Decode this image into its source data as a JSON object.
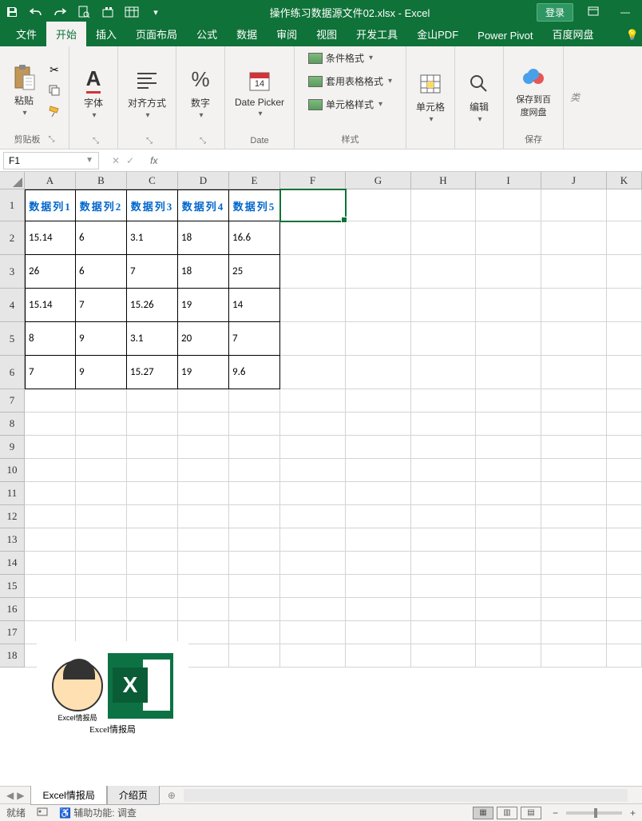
{
  "titlebar": {
    "filename": "操作练习数据源文件02.xlsx",
    "appname": "Excel",
    "separator": " - ",
    "login": "登录"
  },
  "tabs": [
    "文件",
    "开始",
    "插入",
    "页面布局",
    "公式",
    "数据",
    "审阅",
    "视图",
    "开发工具",
    "金山PDF",
    "Power Pivot",
    "百度网盘"
  ],
  "active_tab_index": 1,
  "ribbon": {
    "clipboard": {
      "label": "剪贴板",
      "paste": "粘贴"
    },
    "font": {
      "label": "字体"
    },
    "alignment": {
      "label": "对齐方式"
    },
    "number": {
      "label": "数字"
    },
    "date": {
      "label": "Date",
      "picker": "Date Picker"
    },
    "styles": {
      "label": "样式",
      "conditional": "条件格式",
      "table_format": "套用表格格式",
      "cell_styles": "单元格样式"
    },
    "cells": {
      "label": "单元格"
    },
    "editing": {
      "label": "编辑"
    },
    "save": {
      "label": "保存",
      "btn": "保存到百度网盘"
    }
  },
  "name_box": "F1",
  "formula_value": "",
  "columns": [
    "A",
    "B",
    "C",
    "D",
    "E",
    "F",
    "G",
    "H",
    "I",
    "J",
    "K"
  ],
  "rows": [
    1,
    2,
    3,
    4,
    5,
    6,
    7,
    8,
    9,
    10,
    11,
    12,
    13,
    14,
    15,
    16,
    17,
    18
  ],
  "chart_data": {
    "type": "table",
    "headers": [
      "数据列1",
      "数据列2",
      "数据列3",
      "数据列4",
      "数据列5"
    ],
    "rows": [
      [
        "15.14",
        "6",
        "3.1",
        "18",
        "16.6"
      ],
      [
        "26",
        "6",
        "7",
        "18",
        "25"
      ],
      [
        "15.14",
        "7",
        "15.26",
        "19",
        "14"
      ],
      [
        "8",
        "9",
        "3.1",
        "20",
        "7"
      ],
      [
        "7",
        "9",
        "15.27",
        "19",
        "9.6"
      ]
    ]
  },
  "embedded": {
    "avatar_label": "Excel情报局",
    "caption": "Excel情报局",
    "x_letter": "X"
  },
  "sheet_tabs": {
    "active": "Excel情报局",
    "inactive": "介绍页"
  },
  "status": {
    "ready": "就绪",
    "accessibility": "辅助功能: 调查",
    "zoom_minus": "−",
    "zoom_plus": "+"
  }
}
